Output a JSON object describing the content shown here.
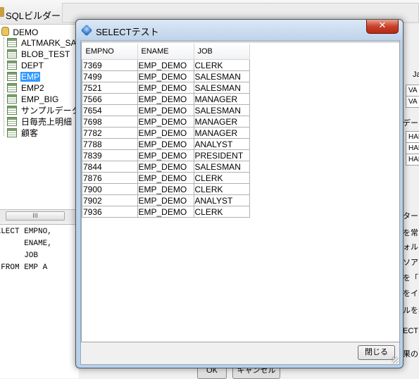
{
  "background": {
    "title": "SQLビルダー",
    "tree": {
      "root": "DEMO",
      "items": [
        {
          "label": "ALTMARK_SAM",
          "selected": false
        },
        {
          "label": "BLOB_TEST",
          "selected": false
        },
        {
          "label": "DEPT",
          "selected": false
        },
        {
          "label": "EMP",
          "selected": true
        },
        {
          "label": "EMP2",
          "selected": false
        },
        {
          "label": "EMP_BIG",
          "selected": false
        },
        {
          "label": "サンプルデータ",
          "selected": false
        },
        {
          "label": "日毎売上明細",
          "selected": false
        },
        {
          "label": "顧客",
          "selected": false
        }
      ],
      "scroll_thumb": "III"
    },
    "sql_lines": [
      "SELECT EMPNO,",
      "       ENAME,",
      "       JOB",
      "  FROM EMP A"
    ],
    "right_fragments": {
      "f1": "Ja",
      "f2": "VA",
      "f3": "VA",
      "f4": "デー",
      "f5": "HAF",
      "f6": "HAF",
      "f7": "HAF",
      "f8": "ター",
      "f9": "を常",
      "f10": "ォルト",
      "f11": "ソアス",
      "f12": "を「",
      "f13": "をイ",
      "f14": "ルをS",
      "f15": "ECT",
      "f16": "果の"
    },
    "bottom_buttons": {
      "ok": "OK",
      "cancel": "キャンセル"
    }
  },
  "dialog": {
    "title": "SELECTテスト",
    "close_glyph": "✕",
    "columns": [
      "EMPNO",
      "ENAME",
      "JOB"
    ],
    "rows": [
      [
        "7369",
        "EMP_DEMO",
        "CLERK"
      ],
      [
        "7499",
        "EMP_DEMO",
        "SALESMAN"
      ],
      [
        "7521",
        "EMP_DEMO",
        "SALESMAN"
      ],
      [
        "7566",
        "EMP_DEMO",
        "MANAGER"
      ],
      [
        "7654",
        "EMP_DEMO",
        "SALESMAN"
      ],
      [
        "7698",
        "EMP_DEMO",
        "MANAGER"
      ],
      [
        "7782",
        "EMP_DEMO",
        "MANAGER"
      ],
      [
        "7788",
        "EMP_DEMO",
        "ANALYST"
      ],
      [
        "7839",
        "EMP_DEMO",
        "PRESIDENT"
      ],
      [
        "7844",
        "EMP_DEMO",
        "SALESMAN"
      ],
      [
        "7876",
        "EMP_DEMO",
        "CLERK"
      ],
      [
        "7900",
        "EMP_DEMO",
        "CLERK"
      ],
      [
        "7902",
        "EMP_DEMO",
        "ANALYST"
      ],
      [
        "7936",
        "EMP_DEMO",
        "CLERK"
      ]
    ],
    "close_button": "閉じる"
  }
}
